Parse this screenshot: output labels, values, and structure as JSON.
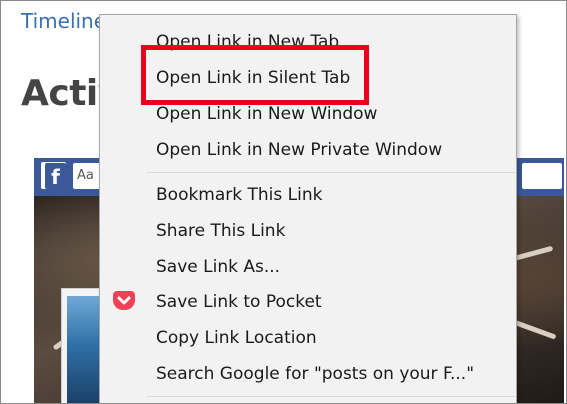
{
  "page": {
    "link_text": "Timelines",
    "heading": "Activ",
    "fb_search_text": "Aa"
  },
  "context_menu": {
    "items": [
      {
        "label": "Open Link in New Tab"
      },
      {
        "label": "Open Link in Silent Tab"
      },
      {
        "label": "Open Link in New Window"
      },
      {
        "label": "Open Link in New Private Window"
      },
      {
        "label": "Bookmark This Link"
      },
      {
        "label": "Share This Link"
      },
      {
        "label": "Save Link As..."
      },
      {
        "label": "Save Link to Pocket"
      },
      {
        "label": "Copy Link Location"
      },
      {
        "label": "Search Google for \"posts on your F...\""
      }
    ]
  },
  "colors": {
    "highlight": "#e8001c",
    "pocket": "#ef4056",
    "facebook": "#3b5998",
    "link": "#3a6fb0"
  },
  "icons": {
    "pocket": "pocket-icon",
    "facebook": "facebook-logo-icon"
  }
}
